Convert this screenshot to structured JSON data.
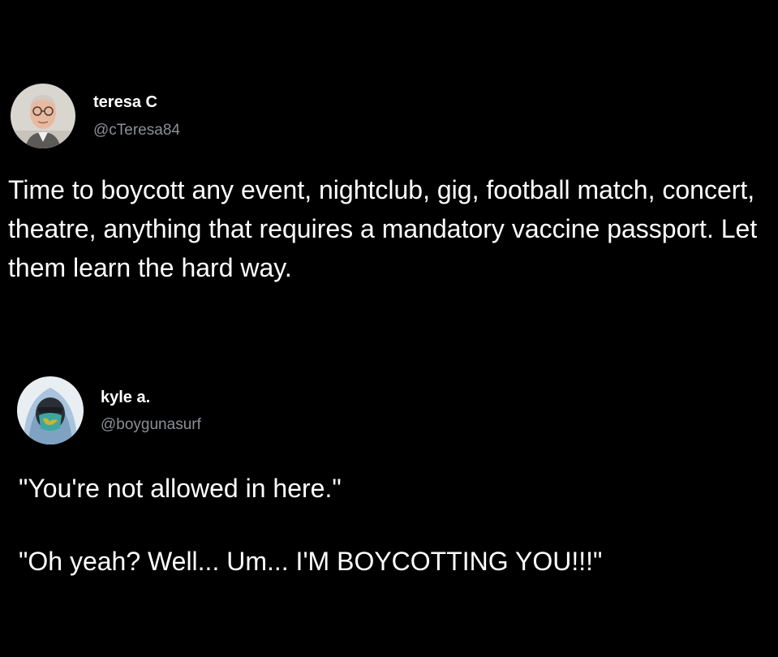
{
  "tweets": [
    {
      "author": {
        "display_name": "teresa C",
        "handle": "@cTeresa84",
        "avatar": "profile-photo-elderly-man-glasses"
      },
      "text": "Time to boycott any event, nightclub, gig, football match, concert, theatre, anything that requires a mandatory vaccine passport. Let them learn the hard way."
    },
    {
      "author": {
        "display_name": "kyle a.",
        "handle": "@boygunasurf",
        "avatar": "profile-photo-hooded-masked-person"
      },
      "text": "\"You're not allowed in here.\"\n\n\"Oh yeah?  Well...  Um...  I'M BOYCOTTING YOU!!!\""
    }
  ],
  "colors": {
    "background": "#000000",
    "text_primary": "#ffffff",
    "text_secondary": "#8b8f94"
  }
}
